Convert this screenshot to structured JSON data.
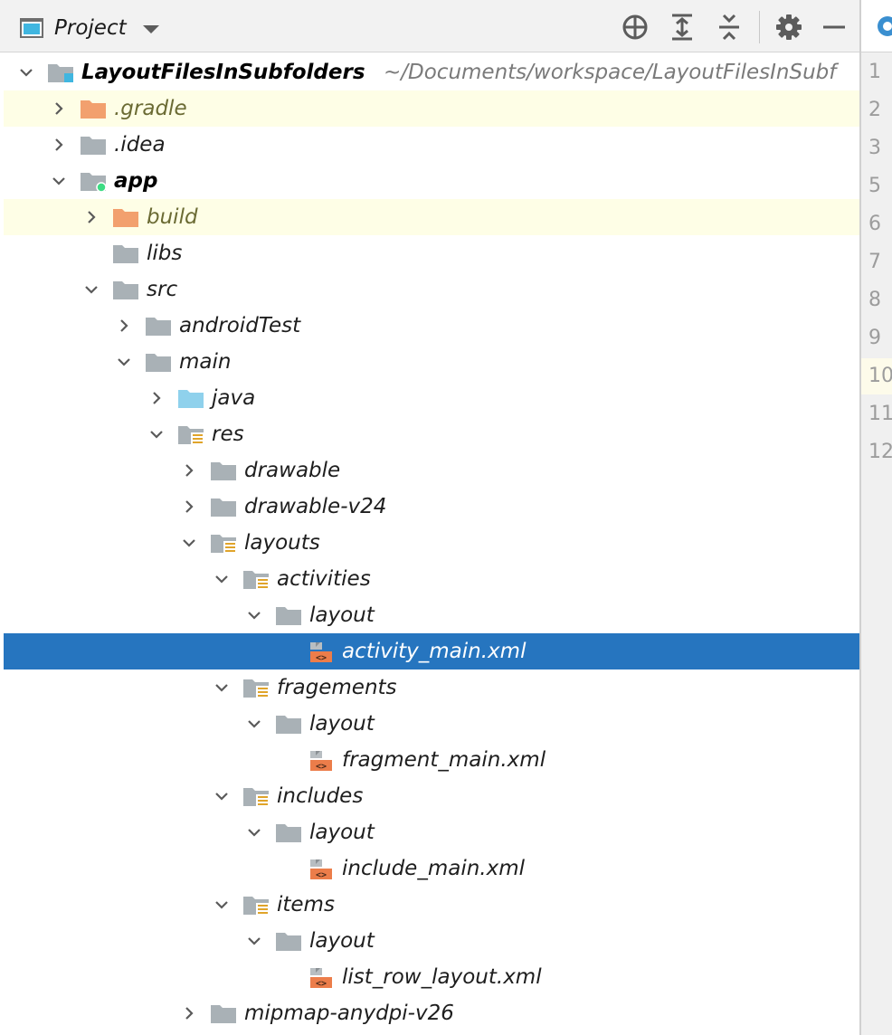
{
  "panel": {
    "title": "Project",
    "toolbar_icons": [
      "locate-icon",
      "expand-all-icon",
      "collapse-all-icon",
      "gear-icon",
      "minimize-icon"
    ]
  },
  "tree": {
    "root": {
      "name": "LayoutFilesInSubfolders",
      "path": "~/Documents/workspace/LayoutFilesInSubf"
    },
    "gradle": ".gradle",
    "idea": ".idea",
    "app": "app",
    "build": "build",
    "libs": "libs",
    "src": "src",
    "androidTest": "androidTest",
    "main": "main",
    "java": "java",
    "res": "res",
    "drawable": "drawable",
    "drawable_v24": "drawable-v24",
    "layouts": "layouts",
    "activities": "activities",
    "activities_layout": "layout",
    "activity_main": "activity_main.xml",
    "fragements": "fragements",
    "fragements_layout": "layout",
    "fragment_main": "fragment_main.xml",
    "includes": "includes",
    "includes_layout": "layout",
    "include_main": "include_main.xml",
    "items": "items",
    "items_layout": "layout",
    "list_row_layout": "list_row_layout.xml",
    "mipmap": "mipmap-anydpi-v26"
  },
  "gutter": {
    "line_numbers": [
      "1",
      "2",
      "3",
      "5",
      "6",
      "7",
      "8",
      "9",
      "10",
      "11",
      "12"
    ]
  },
  "colors": {
    "selection": "#2675bf",
    "excluded_highlight": "#fefee6",
    "folder_gray": "#a9b1b6",
    "folder_orange": "#f2a06e",
    "folder_blue": "#8fd1ec",
    "resource_lines": "#e0a42a",
    "xml_icon": "#ec7d4a"
  }
}
